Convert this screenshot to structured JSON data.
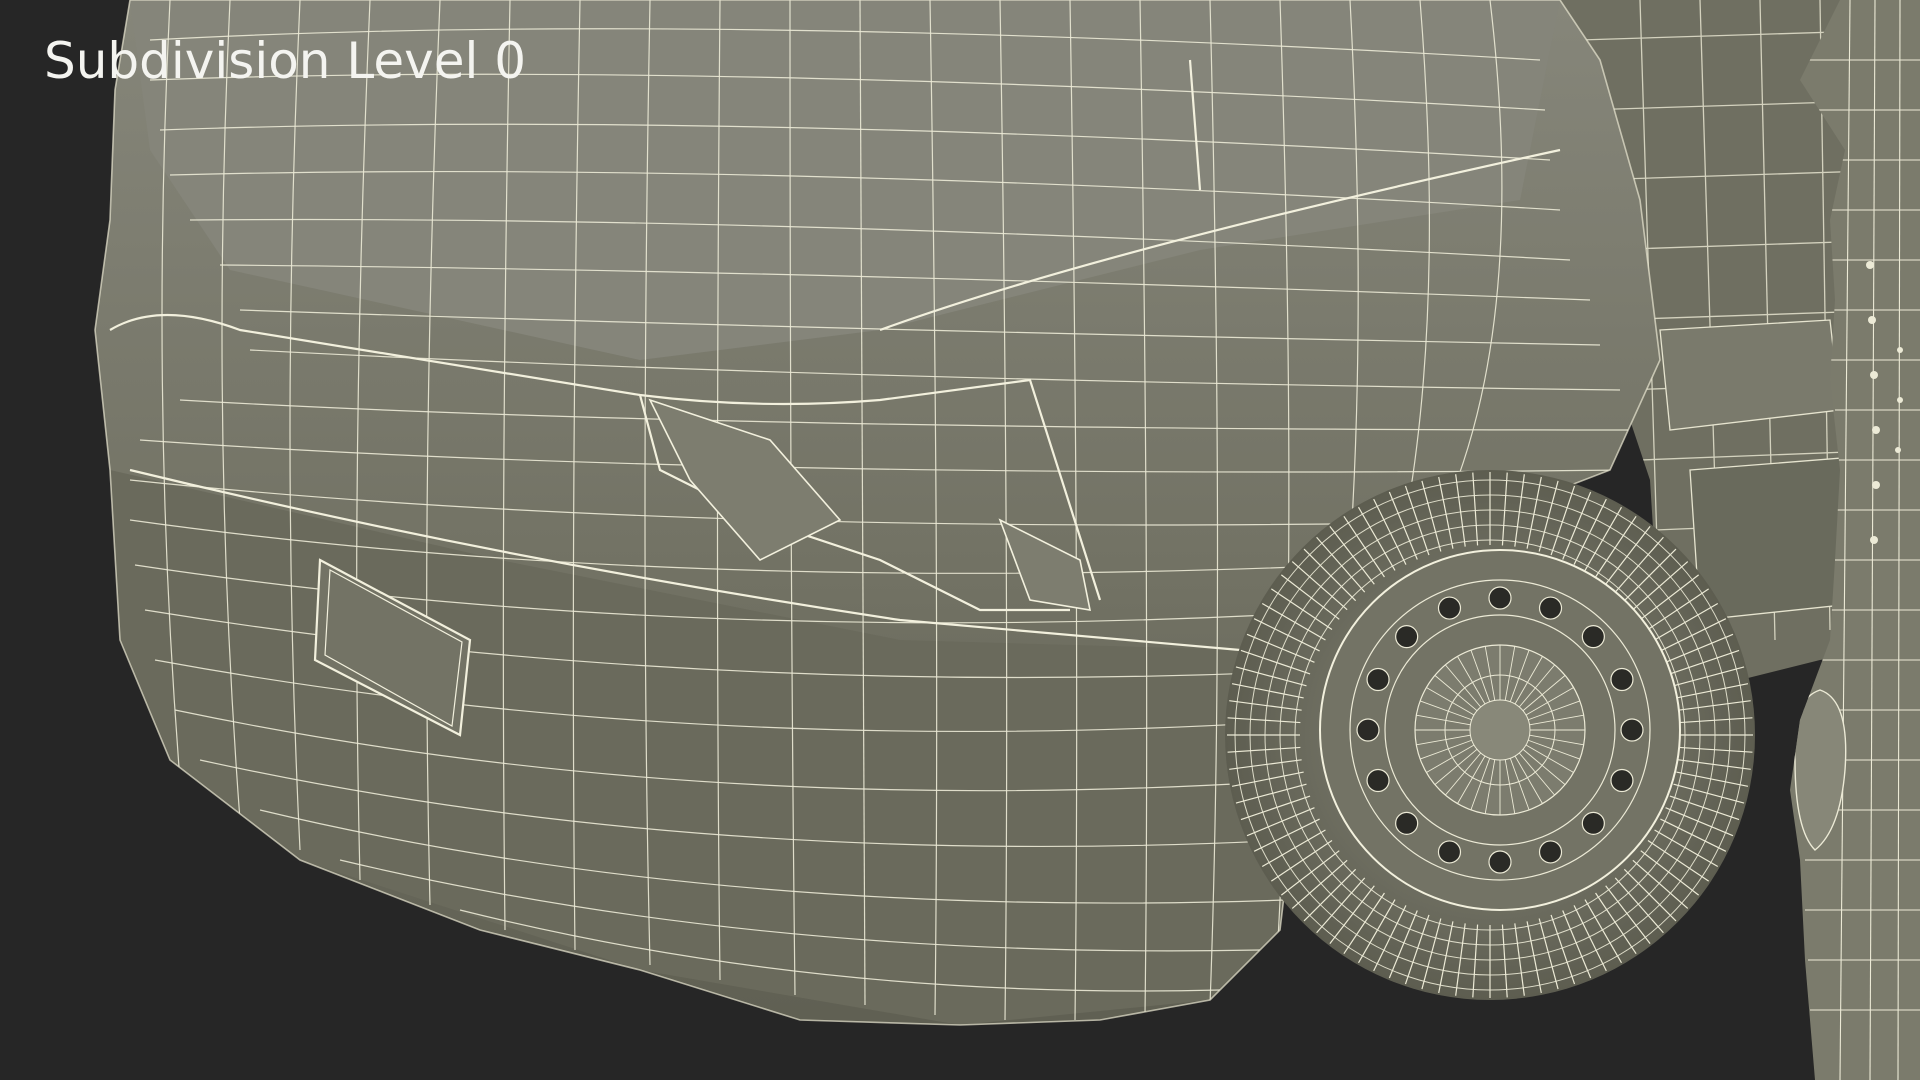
{
  "overlay": {
    "label": "Subdivision Level 0"
  },
  "scene": {
    "background_color": "#262626",
    "surface_color": "#7b7b6b",
    "wire_color": "#e9e7d2"
  }
}
